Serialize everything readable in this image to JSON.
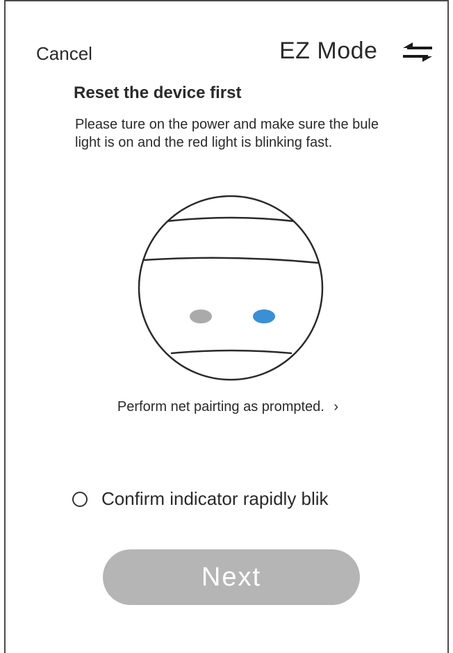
{
  "header": {
    "cancel_label": "Cancel",
    "mode_title": "EZ Mode",
    "switch_icon": "swap-arrows-icon"
  },
  "instructions": {
    "heading": "Reset the device first",
    "description": "Please ture on the power and make sure the bule light is on and the red light is blinking fast."
  },
  "illustration": {
    "indicator_left_color": "#aaaaaa",
    "indicator_right_color": "#3a8fd6"
  },
  "prompt": {
    "text": "Perform net pairting as prompted.",
    "chevron": "›"
  },
  "confirm": {
    "label": "Confirm indicator rapidly blik",
    "checked": false
  },
  "actions": {
    "next_label": "Next",
    "next_color": "#b5b5b5"
  }
}
